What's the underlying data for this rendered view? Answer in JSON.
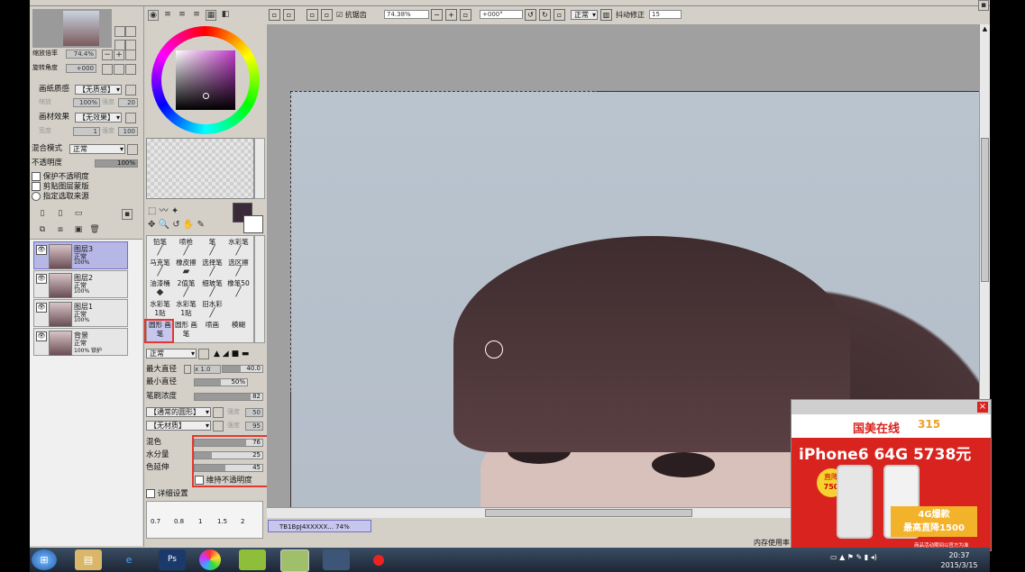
{
  "app": {
    "toolbar": {
      "antialias_label": "抗锯齿",
      "zoom_value": "74.38%",
      "rotate_value": "+000°",
      "mode_value": "正常",
      "stabilizer_label": "抖动修正",
      "stabilizer_value": "15"
    },
    "navigator": {
      "zoom_label": "缩放倍率",
      "zoom_value": "74.4%",
      "rotate_label": "旋转角度",
      "rotate_value": "+000"
    },
    "paper": {
      "texture_label": "画纸质感",
      "texture_value": "【无质感】",
      "scale_label": "缩放",
      "scale_value": "100%",
      "strength_label": "强度",
      "strength_value": "20",
      "effect_label": "画材效果",
      "effect_value": "【无效果】",
      "width_label": "宽度",
      "width_value": "1",
      "effect_strength_label": "强度",
      "effect_strength_value": "100"
    },
    "layer_props": {
      "blend_label": "混合模式",
      "blend_value": "正常",
      "opacity_label": "不透明度",
      "opacity_value": "100%",
      "chk_preserve": "保护不透明度",
      "chk_clip": "剪贴图层蒙版",
      "chk_source": "指定选取来源"
    },
    "layers": [
      {
        "name": "图层3",
        "mode": "正常",
        "opacity": "100%",
        "selected": true
      },
      {
        "name": "图层2",
        "mode": "正常",
        "opacity": "100%",
        "selected": false
      },
      {
        "name": "图层1",
        "mode": "正常",
        "opacity": "100%",
        "selected": false
      },
      {
        "name": "背景",
        "mode": "正常",
        "opacity": "100%  锁护",
        "selected": false
      }
    ],
    "tools": [
      [
        "铅笔",
        "喷枪",
        "笔",
        "水彩笔"
      ],
      [
        "马克笔",
        "橡皮擦",
        "选择笔",
        "选区擦"
      ],
      [
        "油漆桶",
        "2值笔",
        "细玻笔",
        "橡笔50"
      ],
      [
        "水彩笔 1贴",
        "水彩笔 1贴",
        "旧水彩",
        ""
      ],
      [
        "圆形 画笔",
        "圆形 画笔",
        "喷画",
        "模糊"
      ]
    ],
    "brush": {
      "mode_value": "正常",
      "max_size_label": "最大直径",
      "max_size_mult": "x 1.0",
      "max_size_value": "40.0",
      "min_size_label": "最小直径",
      "min_size_value": "50%",
      "density_label": "笔刷浓度",
      "density_value": "82",
      "shape_value": "【通常的圆形】",
      "shape_strength_label": "强度",
      "shape_strength_value": "50",
      "texture_value": "【无材质】",
      "texture_strength_label": "强度",
      "texture_strength_value": "95",
      "blend_label": "混色",
      "blend_value": "76",
      "water_label": "水分量",
      "water_value": "25",
      "persist_label": "色延伸",
      "persist_value": "45",
      "keep_opacity_label": "维持不透明度",
      "advanced_label": "详细设置",
      "size_presets": [
        "0.7",
        "0.8",
        "1",
        "1.5",
        "2"
      ]
    },
    "file_tab": "TB1BpJ4XXXXX... 74%",
    "status": "内存使用率"
  },
  "ad": {
    "brand": "国美在线",
    "badge": "315",
    "headline": "iPhone6  64G  5738元",
    "discount_label": "直降",
    "discount_value": "750",
    "promo_line1": "4G爆款",
    "promo_line2": "最高直降1500",
    "footer": "商品活动期间以官方为准",
    "close": "×"
  },
  "taskbar": {
    "time": "20:37",
    "date": "2015/3/15"
  },
  "colors": {
    "canvas_bg": "#a0a0a0",
    "ad_red": "#d9231e",
    "highlight_red": "#e3372f",
    "layer_selected": "#b7b7e6"
  }
}
